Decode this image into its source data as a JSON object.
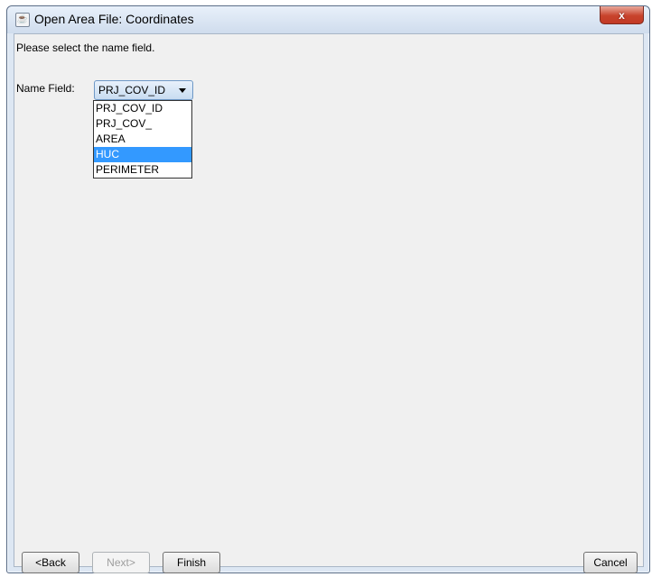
{
  "window": {
    "title": "Open Area File: Coordinates",
    "close_label": "x"
  },
  "content": {
    "instruction": "Please select the name field.",
    "name_field_label": "Name Field:",
    "name_field_value": "PRJ_COV_ID",
    "options": [
      "PRJ_COV_ID",
      "PRJ_COV_",
      "AREA",
      "HUC",
      "PERIMETER"
    ],
    "highlighted_option": "HUC"
  },
  "buttons": {
    "back": "<Back",
    "next": "Next>",
    "finish": "Finish",
    "cancel": "Cancel"
  }
}
